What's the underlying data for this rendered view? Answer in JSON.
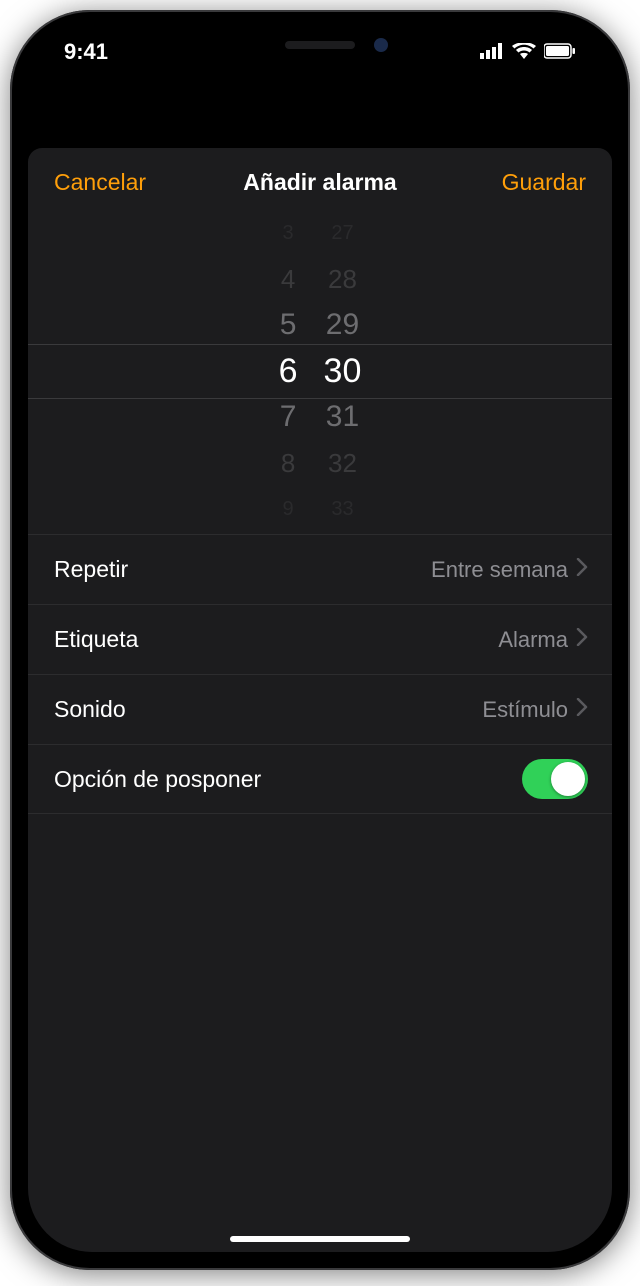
{
  "status": {
    "time": "9:41"
  },
  "nav": {
    "cancel": "Cancelar",
    "title": "Añadir alarma",
    "save": "Guardar"
  },
  "picker": {
    "hours": [
      "3",
      "4",
      "5",
      "6",
      "7",
      "8",
      "9"
    ],
    "minutes": [
      "27",
      "28",
      "29",
      "30",
      "31",
      "32",
      "33"
    ],
    "selected_hour": "6",
    "selected_minute": "30"
  },
  "rows": {
    "repeat": {
      "label": "Repetir",
      "value": "Entre semana"
    },
    "tag": {
      "label": "Etiqueta",
      "value": "Alarma"
    },
    "sound": {
      "label": "Sonido",
      "value": "Estímulo"
    },
    "snooze": {
      "label": "Opción de posponer",
      "on": true
    }
  },
  "colors": {
    "accent": "#ff9f0a",
    "switch_on": "#30d158"
  }
}
